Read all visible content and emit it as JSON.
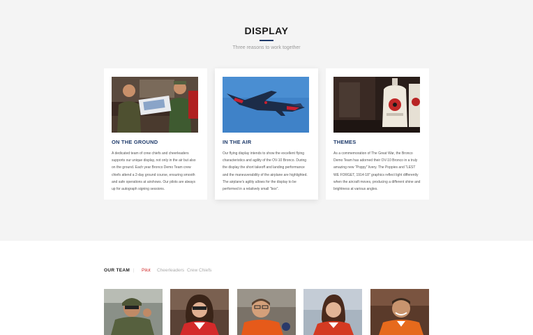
{
  "display": {
    "title": "DISPLAY",
    "subtitle": "Three reasons to work together",
    "cards": [
      {
        "title": "ON THE GROUND",
        "body": "A dedicated team of crew chiefs and cheerleaders supports our unique display, not only in the air but also on the ground. Each year Bronco Demo Team crew chiefs attend a 2-day ground course, ensuring smooth and safe operations at airshows. Our pilots are always up for autograph signing sessions."
      },
      {
        "title": "IN THE AIR",
        "body": "Our flying display intends to show the excellent flying characteristics and agility of the OV-10 Bronco. During the display the short takeoff and landing performance and the maneuverability of the airplane are highlighted. The airplane's agility allows for the display to be performed in a relatively small \"box\"."
      },
      {
        "title": "THEMES",
        "body": "As a commemoration of The Great War, the Bronco Demo Team has adorned their OV-10 Bronco in a truly amazing new \"Poppy\" livery. The Poppies and \"LEST WE FORGET, 1914-18\" graphics reflect light differently when the aircraft moves, producing a different shine and brightness at various angles."
      }
    ]
  },
  "team": {
    "label": "OUR TEAM",
    "separator": "|",
    "tabs": [
      "Pilot",
      "Cheerleaders",
      "Crew Chiefs"
    ],
    "active_tab": "Pilot"
  },
  "colors": {
    "accent": "#1f3b6b",
    "active_tab": "#d12a2a"
  }
}
